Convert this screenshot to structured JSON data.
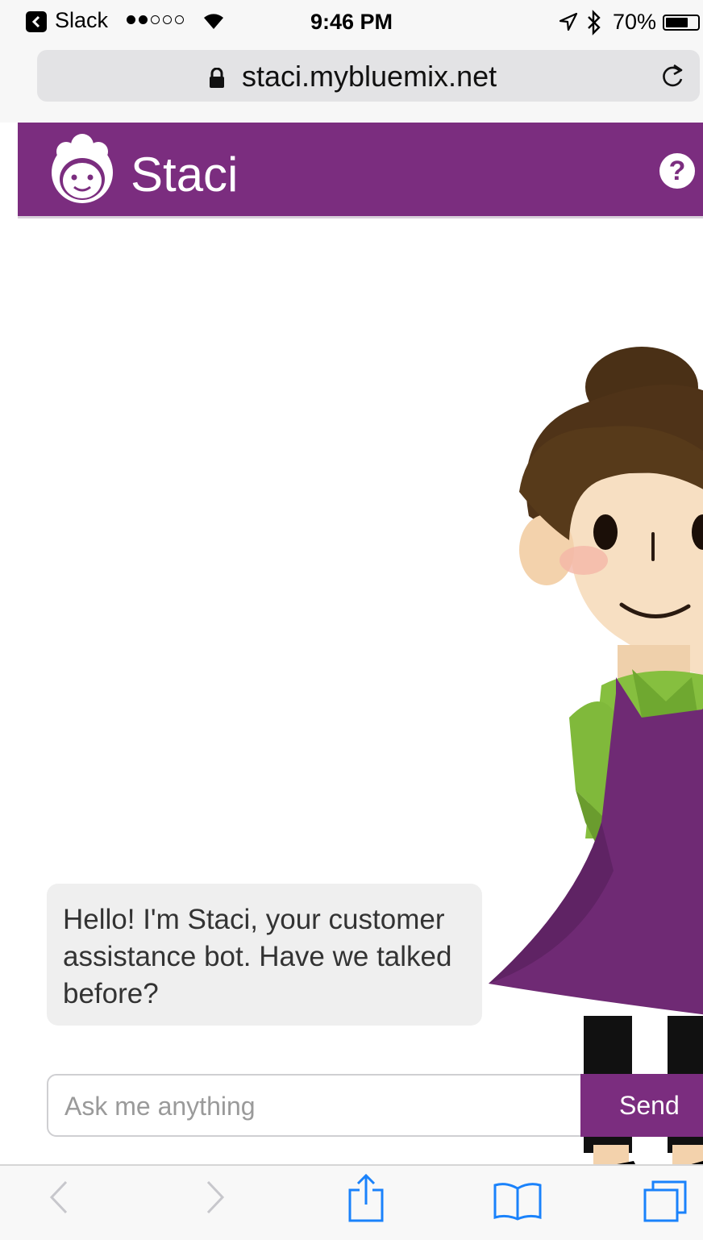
{
  "status_bar": {
    "back_app": "Slack",
    "signal_dots": [
      "on",
      "on",
      "off",
      "off",
      "off"
    ],
    "time": "9:46 PM",
    "battery": "70%",
    "battery_level": 0.7,
    "icons": [
      "back-icon",
      "wifi-icon",
      "location-icon",
      "bluetooth-icon",
      "battery-icon"
    ]
  },
  "browser": {
    "url": "staci.mybluemix.net",
    "icons": [
      "lock-icon",
      "reload-icon"
    ]
  },
  "header": {
    "title": "Staci",
    "icons": [
      "staci-logo-icon",
      "help-icon"
    ],
    "help_symbol": "?",
    "color": "#7b2d7f"
  },
  "chat": {
    "messages": [
      {
        "from": "bot",
        "text": "Hello! I'm Staci, your customer assistance bot. Have we talked before?"
      }
    ],
    "input_placeholder": "Ask me anything",
    "send_label": "Send"
  },
  "toolbar": {
    "icons": [
      "back-arrow-icon",
      "forward-arrow-icon",
      "share-icon",
      "bookmarks-icon",
      "tabs-icon"
    ]
  },
  "colors": {
    "brand": "#7b2d7f",
    "bubble": "#efefef",
    "ios_blue": "#1a82fb"
  }
}
